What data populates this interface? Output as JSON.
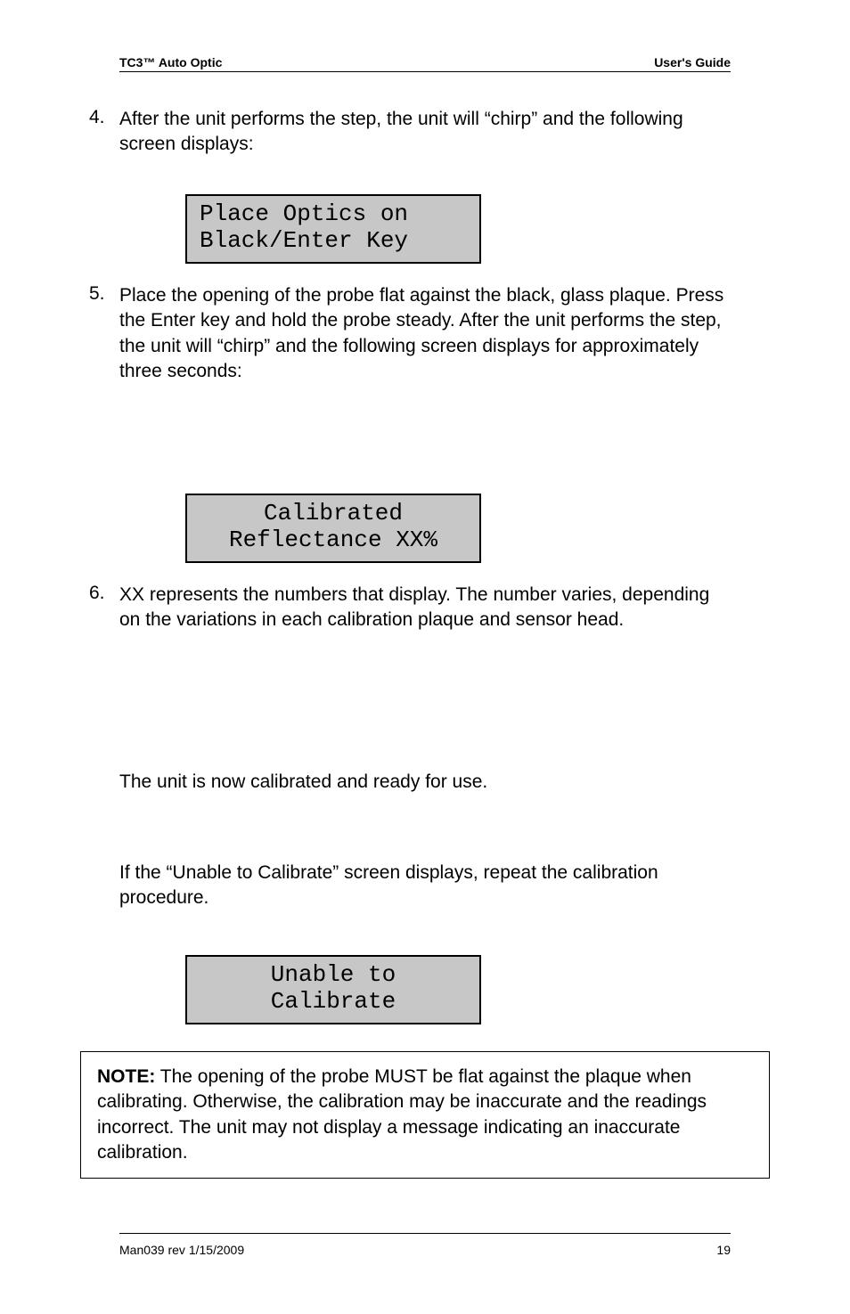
{
  "header": {
    "left": "TC3™ Auto Optic",
    "right": "User's Guide"
  },
  "steps": {
    "s4_num": "4.",
    "s4_text": "After the unit performs the step, the unit will “chirp” and the following screen displays:",
    "s5_num": "5.",
    "s5_text": "Place the opening of the probe flat against the black, glass plaque. Press the Enter key and hold the probe steady. After the unit performs the step, the unit will “chirp” and the following screen displays for approximately three seconds:",
    "s6_num": "6.",
    "s6_text": "XX represents the numbers that display. The number varies, depending on the variations in each calibration plaque and sensor head."
  },
  "paragraphs": {
    "ready": "The unit is now calibrated and ready for use.",
    "unable": "If the “Unable to Calibrate” screen displays, repeat the calibration procedure."
  },
  "lcd": {
    "lcd1_row1": "Place Optics on",
    "lcd1_row2": "Black/Enter Key",
    "lcd2_row1": "Calibrated",
    "lcd2_row2": "Reflectance  XX%",
    "lcd3_row1": "Unable to",
    "lcd3_row2": "Calibrate"
  },
  "note": {
    "bold": "NOTE:",
    "text": " The opening of the probe MUST be flat against the plaque when calibrating. Otherwise, the calibration may be inaccurate and the readings incorrect. The unit may not display a message indicating an inaccurate calibration."
  },
  "footer": {
    "left": "Man039 rev 1/15/2009",
    "right": "19"
  }
}
